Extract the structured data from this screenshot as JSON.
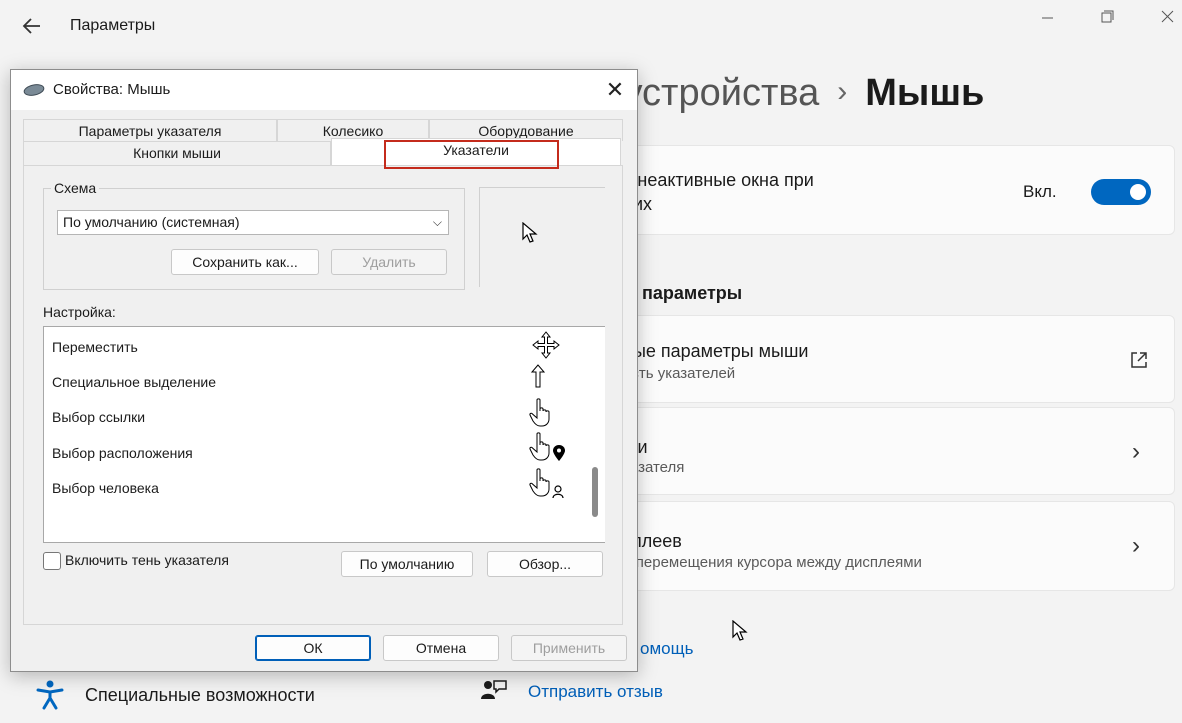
{
  "settings": {
    "app_title": "Параметры",
    "breadcrumb": {
      "parent": "h и устройства",
      "separator": "›",
      "current": "Мышь"
    },
    "scroll_inactive": {
      "title_line1": "ь неактивные окна при",
      "title_line2": "них",
      "toggle_label": "Вкл.",
      "toggle_on": true
    },
    "section_label": "параметры",
    "additional_mouse": {
      "title": "ные параметры мыши",
      "subtitle": "ость указателей"
    },
    "pointer_card": {
      "title": "ши",
      "subtitle": "казателя"
    },
    "displays_card": {
      "title": "сплеев",
      "subtitle": "б перемещения курсора между дисплеями"
    },
    "help_link": "омощь",
    "feedback_link": "Отправить отзыв",
    "accessibility_label": "Специальные возможности",
    "accent_color": "#0067c0"
  },
  "dialog": {
    "title": "Свойства: Мышь",
    "tabs_row1": [
      "Параметры указателя",
      "Колесико",
      "Оборудование"
    ],
    "tabs_row2": [
      "Кнопки мыши",
      "Указатели"
    ],
    "active_tab": "Указатели",
    "scheme": {
      "label": "Схема",
      "selected": "По умолчанию (системная)",
      "save_button": "Сохранить как...",
      "delete_button": "Удалить"
    },
    "customize_label": "Настройка:",
    "pointers": [
      {
        "label": "Переместить",
        "icon": "move-cursor-icon"
      },
      {
        "label": "Специальное выделение",
        "icon": "alternate-select-cursor-icon"
      },
      {
        "label": "Выбор ссылки",
        "icon": "link-select-cursor-icon"
      },
      {
        "label": "Выбор расположения",
        "icon": "location-select-cursor-icon"
      },
      {
        "label": "Выбор человека",
        "icon": "person-select-cursor-icon"
      }
    ],
    "shadow_checkbox": {
      "label": "Включить тень указателя",
      "checked": false
    },
    "default_button": "По умолчанию",
    "browse_button": "Обзор...",
    "ok_button": "ОК",
    "cancel_button": "Отмена",
    "apply_button": "Применить",
    "highlight_color": "#c42b1c"
  }
}
